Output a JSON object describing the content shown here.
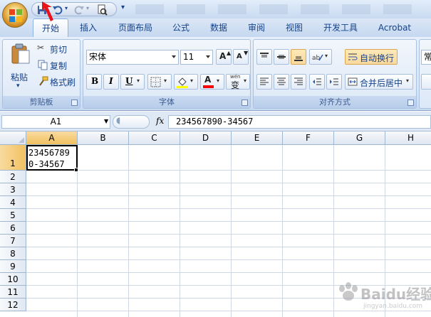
{
  "title_bar": {
    "qat_icons": [
      "save-icon",
      "undo-icon",
      "redo-icon",
      "print-preview-icon",
      "customize-icon"
    ]
  },
  "tabs": [
    {
      "label": "开始",
      "active": true
    },
    {
      "label": "插入"
    },
    {
      "label": "页面布局"
    },
    {
      "label": "公式"
    },
    {
      "label": "数据"
    },
    {
      "label": "审阅"
    },
    {
      "label": "视图"
    },
    {
      "label": "开发工具"
    },
    {
      "label": "Acrobat"
    }
  ],
  "clipboard": {
    "paste": "粘贴",
    "cut": "剪切",
    "copy": "复制",
    "format_painter": "格式刷",
    "label": "剪贴板"
  },
  "font": {
    "name": "宋体",
    "size": "11",
    "bold": "B",
    "italic": "I",
    "underline": "U",
    "font_color_letter": "A",
    "phonetic": "变",
    "phonetic_top": "wén",
    "grow": "A",
    "shrink": "A",
    "label": "字体",
    "fill_color": "#ffff00",
    "font_color": "#ff0000"
  },
  "alignment": {
    "wrap_text": "自动换行",
    "merge_center": "合并后居中",
    "label": "对齐方式"
  },
  "number": {
    "partial": "常"
  },
  "formula_bar": {
    "name_box": "A1",
    "fx": "fx",
    "formula": "234567890-34567"
  },
  "grid": {
    "columns": [
      "A",
      "B",
      "C",
      "D",
      "E",
      "F",
      "G",
      "H"
    ],
    "rows": [
      "1",
      "2",
      "3",
      "4",
      "5",
      "6",
      "7",
      "8",
      "9",
      "10",
      "11",
      "12"
    ],
    "a1_value": "234567890-34567",
    "a1_line1": "23456789",
    "a1_line2": "0-34567"
  },
  "watermark": {
    "text": "Baidu经验",
    "sub": "jingyan.baidu.com"
  },
  "colors": {
    "accent": "#15428b",
    "selection": "#f9d99f",
    "ribbon_bg": "#dbe6f6"
  }
}
